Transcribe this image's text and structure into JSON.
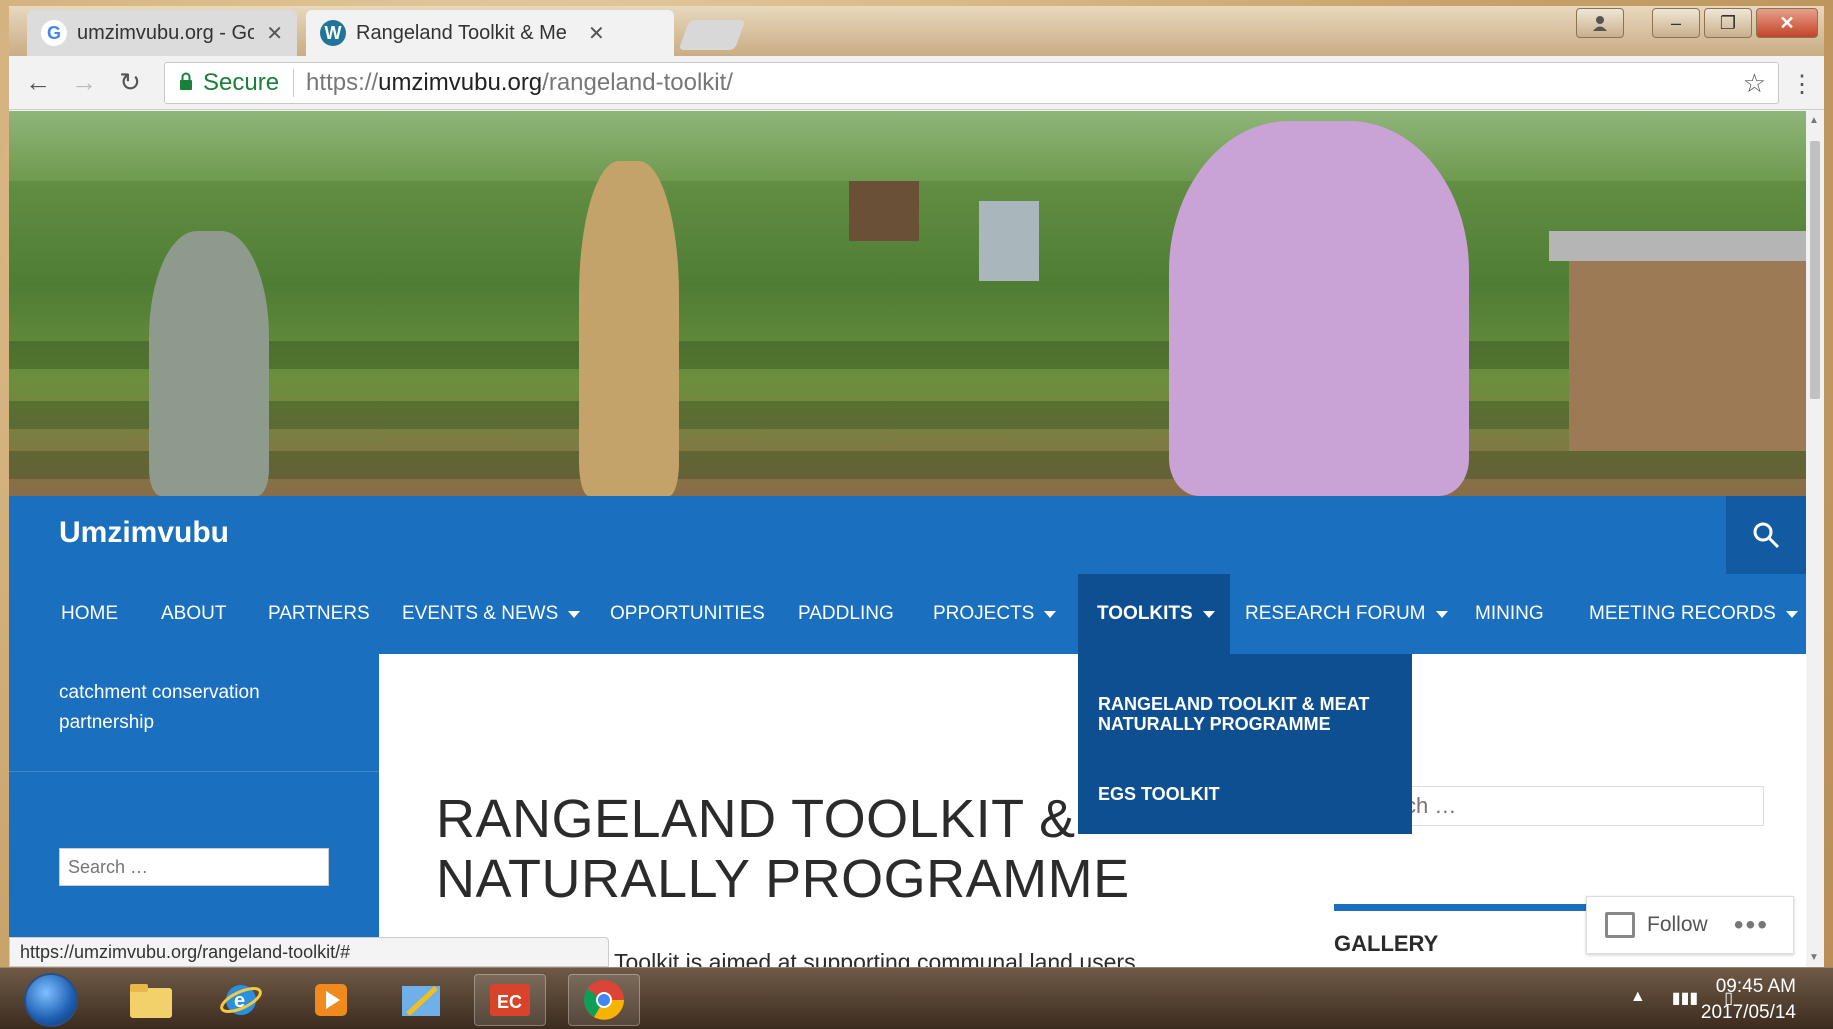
{
  "browser": {
    "tabs": [
      {
        "title": "umzimvubu.org - Google",
        "icon": "google-icon",
        "active": false
      },
      {
        "title": "Rangeland Toolkit & Me",
        "icon": "wordpress-icon",
        "active": true
      }
    ],
    "address": {
      "secure_label": "Secure",
      "url_protocol": "https://",
      "url_host": "umzimvubu.org",
      "url_path": "/rangeland-toolkit/"
    },
    "status_url": "https://umzimvubu.org/rangeland-toolkit/#"
  },
  "site": {
    "title": "Umzimvubu",
    "tagline": "catchment conservation partnership",
    "nav": [
      {
        "label": "HOME",
        "dropdown": false
      },
      {
        "label": "ABOUT",
        "dropdown": false
      },
      {
        "label": "PARTNERS",
        "dropdown": false
      },
      {
        "label": "EVENTS & NEWS",
        "dropdown": true
      },
      {
        "label": "OPPORTUNITIES",
        "dropdown": false
      },
      {
        "label": "PADDLING",
        "dropdown": false
      },
      {
        "label": "PROJECTS",
        "dropdown": true
      },
      {
        "label": "TOOLKITS",
        "dropdown": true
      },
      {
        "label": "RESEARCH FORUM",
        "dropdown": true
      },
      {
        "label": "MINING",
        "dropdown": false
      },
      {
        "label": "MEETING RECORDS",
        "dropdown": true
      }
    ],
    "active_nav": "TOOLKITS",
    "dropdown_items": [
      "RANGELAND TOOLKIT & MEAT NATURALLY PROGRAMME",
      "EGS TOOLKIT"
    ],
    "left_search_placeholder": "Search …",
    "right_search_placeholder": "ch …"
  },
  "content": {
    "title_line1": "RANGELAND TOOLKIT &",
    "title_line2": "NATURALLY PROGRAMME",
    "intro": "Toolkit is aimed at supporting communal land users"
  },
  "sidebar": {
    "gallery_title": "GALLERY",
    "follow_label": "Follow",
    "more_label": "•••"
  },
  "taskbar": {
    "time": "09:45 AM",
    "date": "2017/05/14"
  },
  "colors": {
    "brand_blue": "#1b6fbf",
    "brand_dark_blue": "#0e4f91",
    "secure_green": "#188038"
  }
}
